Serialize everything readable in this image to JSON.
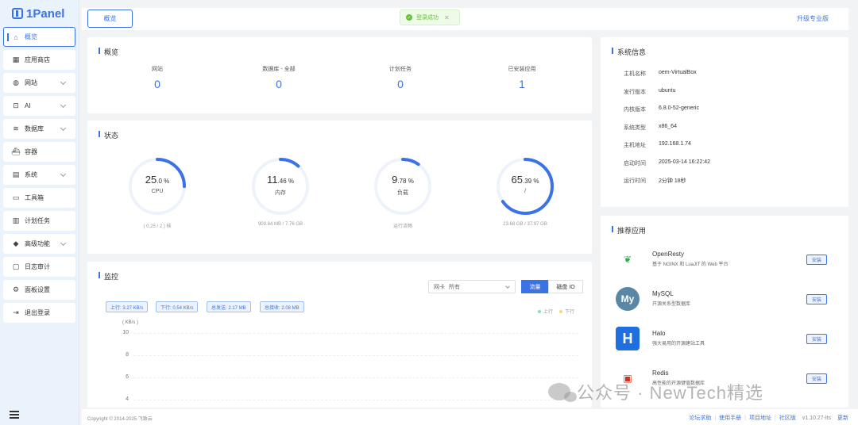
{
  "brand": {
    "name": "1Panel"
  },
  "sidebar": {
    "items": [
      {
        "label": "概览",
        "icon": "home-icon",
        "active": true
      },
      {
        "label": "应用商店",
        "icon": "grid-icon"
      },
      {
        "label": "网站",
        "icon": "globe-icon",
        "expandable": true
      },
      {
        "label": "AI",
        "icon": "robot-icon",
        "expandable": true
      },
      {
        "label": "数据库",
        "icon": "layers-icon",
        "expandable": true
      },
      {
        "label": "容器",
        "icon": "ship-icon"
      },
      {
        "label": "系统",
        "icon": "document-icon",
        "expandable": true
      },
      {
        "label": "工具箱",
        "icon": "toolbox-icon"
      },
      {
        "label": "计划任务",
        "icon": "calendar-icon"
      },
      {
        "label": "高级功能",
        "icon": "diamond-icon",
        "expandable": true
      },
      {
        "label": "日志审计",
        "icon": "log-icon"
      },
      {
        "label": "面板设置",
        "icon": "gear-icon"
      },
      {
        "label": "退出登录",
        "icon": "logout-icon"
      }
    ]
  },
  "topbar": {
    "tab": "概览",
    "upgrade": "升级专业版"
  },
  "toast": {
    "message": "登录成功",
    "close": "✕"
  },
  "overview": {
    "title": "概览",
    "stats": [
      {
        "label": "网站",
        "value": "0"
      },
      {
        "label": "数据库 - 全部",
        "value": "0"
      },
      {
        "label": "计划任务",
        "value": "0"
      },
      {
        "label": "已安装应用",
        "value": "1"
      }
    ]
  },
  "status": {
    "title": "状态",
    "gauges": [
      {
        "int": "25",
        "dec": ".0 %",
        "name": "CPU",
        "percent": 25.0,
        "sub": "( 0.25 / 2 ) 核",
        "color": "#3b73e6"
      },
      {
        "int": "11",
        "dec": ".46 %",
        "name": "内存",
        "percent": 11.46,
        "sub": "909.84 MB / 7.76 GB",
        "color": "#3b73e6"
      },
      {
        "int": "9",
        "dec": ".78 %",
        "name": "负载",
        "percent": 9.78,
        "sub": "运行流畅",
        "color": "#3b73e6"
      },
      {
        "int": "65",
        "dec": ".39 %",
        "name": "/",
        "percent": 65.39,
        "sub": "23.68 GB / 37.97 GB",
        "color": "#3b73e6"
      }
    ]
  },
  "monitor": {
    "title": "监控",
    "select_label": "网卡",
    "select_value": "所有",
    "seg_traffic": "流量",
    "seg_disk": "磁盘 IO",
    "tags": [
      "上行: 3.27 KB/s",
      "下行: 0.54 KB/s",
      "总发送: 2.17 MB",
      "总接收: 2.08 MB"
    ],
    "legend": [
      {
        "name": "上行",
        "color": "#8fd9b6"
      },
      {
        "name": "下行",
        "color": "#f7d77a"
      }
    ],
    "y_unit": "( KB/s )",
    "y_ticks": [
      "10",
      "8",
      "6",
      "4"
    ]
  },
  "sysinfo": {
    "title": "系统信息",
    "rows": [
      {
        "key": "主机名称",
        "value": "oem-VirtualBox"
      },
      {
        "key": "发行版本",
        "value": "ubuntu"
      },
      {
        "key": "内核版本",
        "value": "6.8.0-52-generic"
      },
      {
        "key": "系统类型",
        "value": "x86_64"
      },
      {
        "key": "主机地址",
        "value": "192.168.1.74"
      },
      {
        "key": "启动时间",
        "value": "2025-03-14 16:22:42"
      },
      {
        "key": "运行时间",
        "value": "2分钟 18秒"
      }
    ]
  },
  "apps": {
    "title": "推荐应用",
    "install": "安装",
    "items": [
      {
        "name": "OpenResty",
        "desc": "基于 NGINX 和 LuaJIT 的 Web 平台"
      },
      {
        "name": "MySQL",
        "desc": "开源关系型数据库"
      },
      {
        "name": "Halo",
        "desc": "强大易用的开源建站工具"
      },
      {
        "name": "Redis",
        "desc": "高性能的开源键值数据库"
      }
    ]
  },
  "footer": {
    "copyright": "Copyright © 2014-2025 飞致云",
    "links": [
      "论坛求助",
      "使用手册",
      "项目地址",
      "社区版"
    ],
    "version": "v1.10.27-lts",
    "update": "更新"
  },
  "watermark": {
    "text": "公众号 · NewTech精选"
  }
}
